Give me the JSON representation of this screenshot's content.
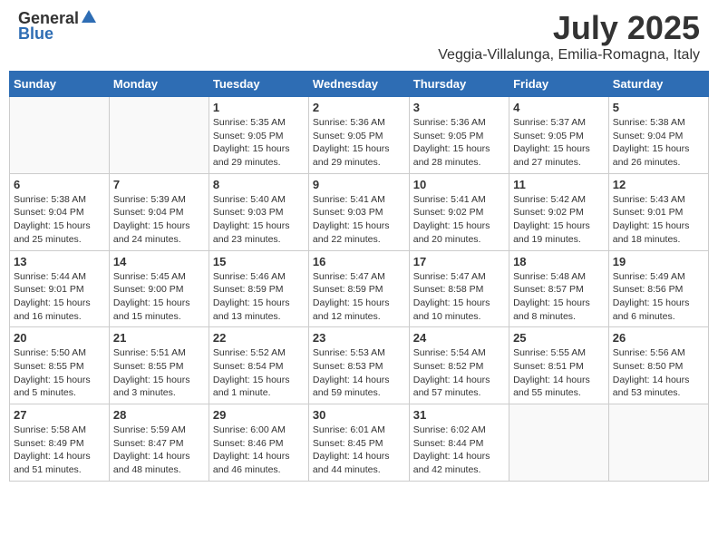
{
  "header": {
    "logo_general": "General",
    "logo_blue": "Blue",
    "month": "July 2025",
    "location": "Veggia-Villalunga, Emilia-Romagna, Italy"
  },
  "weekdays": [
    "Sunday",
    "Monday",
    "Tuesday",
    "Wednesday",
    "Thursday",
    "Friday",
    "Saturday"
  ],
  "weeks": [
    [
      {
        "day": "",
        "info": ""
      },
      {
        "day": "",
        "info": ""
      },
      {
        "day": "1",
        "info": "Sunrise: 5:35 AM\nSunset: 9:05 PM\nDaylight: 15 hours\nand 29 minutes."
      },
      {
        "day": "2",
        "info": "Sunrise: 5:36 AM\nSunset: 9:05 PM\nDaylight: 15 hours\nand 29 minutes."
      },
      {
        "day": "3",
        "info": "Sunrise: 5:36 AM\nSunset: 9:05 PM\nDaylight: 15 hours\nand 28 minutes."
      },
      {
        "day": "4",
        "info": "Sunrise: 5:37 AM\nSunset: 9:05 PM\nDaylight: 15 hours\nand 27 minutes."
      },
      {
        "day": "5",
        "info": "Sunrise: 5:38 AM\nSunset: 9:04 PM\nDaylight: 15 hours\nand 26 minutes."
      }
    ],
    [
      {
        "day": "6",
        "info": "Sunrise: 5:38 AM\nSunset: 9:04 PM\nDaylight: 15 hours\nand 25 minutes."
      },
      {
        "day": "7",
        "info": "Sunrise: 5:39 AM\nSunset: 9:04 PM\nDaylight: 15 hours\nand 24 minutes."
      },
      {
        "day": "8",
        "info": "Sunrise: 5:40 AM\nSunset: 9:03 PM\nDaylight: 15 hours\nand 23 minutes."
      },
      {
        "day": "9",
        "info": "Sunrise: 5:41 AM\nSunset: 9:03 PM\nDaylight: 15 hours\nand 22 minutes."
      },
      {
        "day": "10",
        "info": "Sunrise: 5:41 AM\nSunset: 9:02 PM\nDaylight: 15 hours\nand 20 minutes."
      },
      {
        "day": "11",
        "info": "Sunrise: 5:42 AM\nSunset: 9:02 PM\nDaylight: 15 hours\nand 19 minutes."
      },
      {
        "day": "12",
        "info": "Sunrise: 5:43 AM\nSunset: 9:01 PM\nDaylight: 15 hours\nand 18 minutes."
      }
    ],
    [
      {
        "day": "13",
        "info": "Sunrise: 5:44 AM\nSunset: 9:01 PM\nDaylight: 15 hours\nand 16 minutes."
      },
      {
        "day": "14",
        "info": "Sunrise: 5:45 AM\nSunset: 9:00 PM\nDaylight: 15 hours\nand 15 minutes."
      },
      {
        "day": "15",
        "info": "Sunrise: 5:46 AM\nSunset: 8:59 PM\nDaylight: 15 hours\nand 13 minutes."
      },
      {
        "day": "16",
        "info": "Sunrise: 5:47 AM\nSunset: 8:59 PM\nDaylight: 15 hours\nand 12 minutes."
      },
      {
        "day": "17",
        "info": "Sunrise: 5:47 AM\nSunset: 8:58 PM\nDaylight: 15 hours\nand 10 minutes."
      },
      {
        "day": "18",
        "info": "Sunrise: 5:48 AM\nSunset: 8:57 PM\nDaylight: 15 hours\nand 8 minutes."
      },
      {
        "day": "19",
        "info": "Sunrise: 5:49 AM\nSunset: 8:56 PM\nDaylight: 15 hours\nand 6 minutes."
      }
    ],
    [
      {
        "day": "20",
        "info": "Sunrise: 5:50 AM\nSunset: 8:55 PM\nDaylight: 15 hours\nand 5 minutes."
      },
      {
        "day": "21",
        "info": "Sunrise: 5:51 AM\nSunset: 8:55 PM\nDaylight: 15 hours\nand 3 minutes."
      },
      {
        "day": "22",
        "info": "Sunrise: 5:52 AM\nSunset: 8:54 PM\nDaylight: 15 hours\nand 1 minute."
      },
      {
        "day": "23",
        "info": "Sunrise: 5:53 AM\nSunset: 8:53 PM\nDaylight: 14 hours\nand 59 minutes."
      },
      {
        "day": "24",
        "info": "Sunrise: 5:54 AM\nSunset: 8:52 PM\nDaylight: 14 hours\nand 57 minutes."
      },
      {
        "day": "25",
        "info": "Sunrise: 5:55 AM\nSunset: 8:51 PM\nDaylight: 14 hours\nand 55 minutes."
      },
      {
        "day": "26",
        "info": "Sunrise: 5:56 AM\nSunset: 8:50 PM\nDaylight: 14 hours\nand 53 minutes."
      }
    ],
    [
      {
        "day": "27",
        "info": "Sunrise: 5:58 AM\nSunset: 8:49 PM\nDaylight: 14 hours\nand 51 minutes."
      },
      {
        "day": "28",
        "info": "Sunrise: 5:59 AM\nSunset: 8:47 PM\nDaylight: 14 hours\nand 48 minutes."
      },
      {
        "day": "29",
        "info": "Sunrise: 6:00 AM\nSunset: 8:46 PM\nDaylight: 14 hours\nand 46 minutes."
      },
      {
        "day": "30",
        "info": "Sunrise: 6:01 AM\nSunset: 8:45 PM\nDaylight: 14 hours\nand 44 minutes."
      },
      {
        "day": "31",
        "info": "Sunrise: 6:02 AM\nSunset: 8:44 PM\nDaylight: 14 hours\nand 42 minutes."
      },
      {
        "day": "",
        "info": ""
      },
      {
        "day": "",
        "info": ""
      }
    ]
  ]
}
